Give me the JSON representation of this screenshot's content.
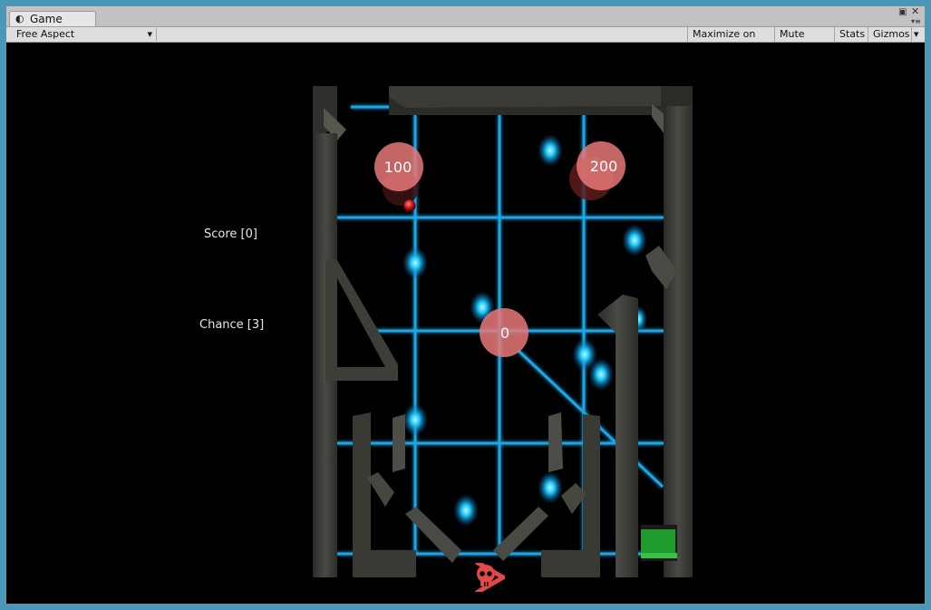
{
  "window": {
    "tab_title": "Game",
    "tab_icon": "unity-game-icon"
  },
  "toolbar": {
    "aspect": "Free Aspect",
    "maximize_on_play": "Maximize on Play",
    "mute_audio": "Mute audio",
    "stats": "Stats",
    "gizmos": "Gizmos"
  },
  "hud": {
    "score": "Score [0]",
    "chance": "Chance [3]"
  },
  "bumpers": [
    {
      "label": "100"
    },
    {
      "label": "200"
    },
    {
      "label": "0"
    }
  ],
  "colors": {
    "grid": "#1aa6e6",
    "bumper": "#e87878",
    "ball": "#cc1111",
    "skull": "#e34848",
    "wall": "#3a3a36",
    "goal": "#1e9b2a"
  },
  "icons": {
    "drain": "skull-crossbones-icon"
  }
}
